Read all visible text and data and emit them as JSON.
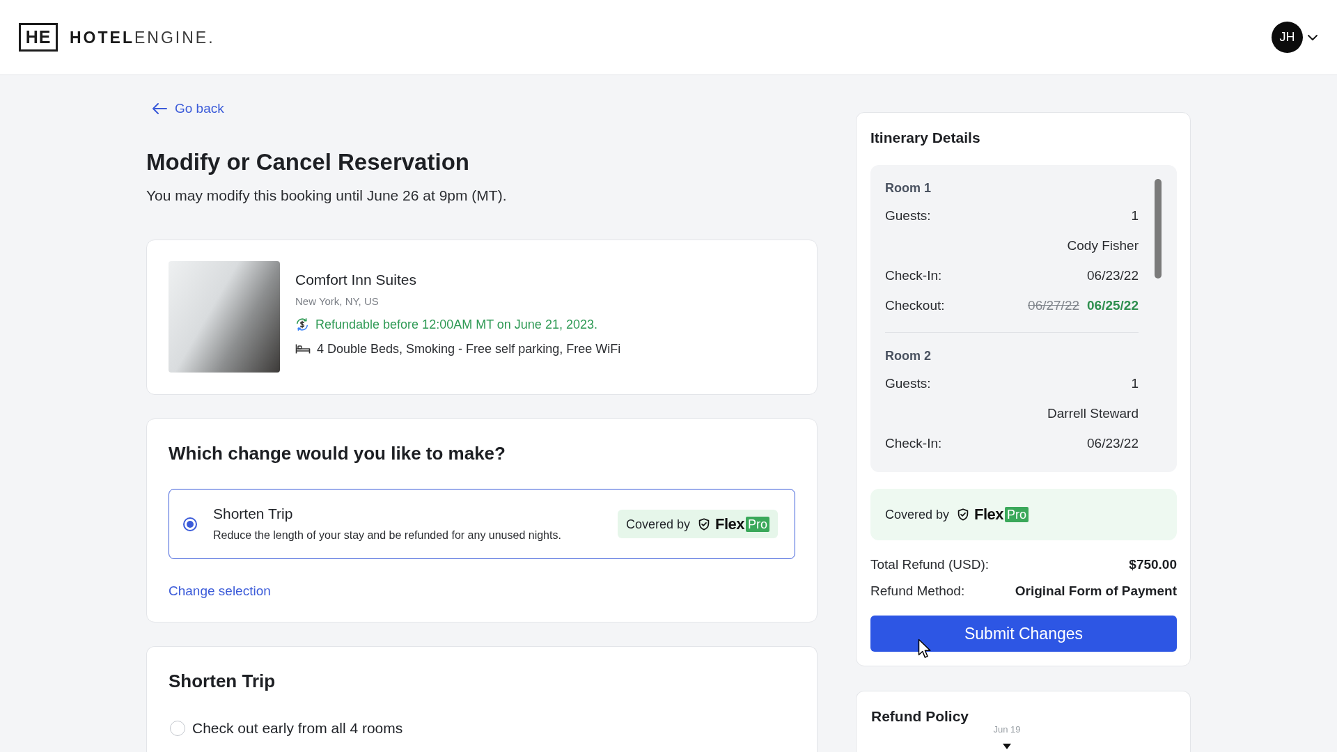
{
  "header": {
    "logo": {
      "mark": "HE",
      "wordmark": "**HOTEL**ENGINE."
    },
    "avatar": {
      "initials": "JH"
    }
  },
  "back_link": {
    "label": "Go back"
  },
  "page": {
    "title": "Modify or Cancel Reservation",
    "subtitle": "You may modify this booking until June 26 at 9pm (MT)."
  },
  "hotel": {
    "name": "Comfort Inn Suites",
    "location": "New York, NY, US",
    "details": [
      {
        "kind": "refund",
        "text": "Refundable before 12:00AM MT on June 21, 2023."
      },
      {
        "kind": "amenities",
        "text": "4 Double Beds, Smoking - Free self parking, Free WiFi"
      }
    ]
  },
  "change_section": {
    "heading": "Which change would you like to make?",
    "options": [
      {
        "title": "Shorten Trip",
        "description": "Reduce the length of your stay and be refunded for any unused nights.",
        "selected": true,
        "badge": {
          "prefix": "Covered by",
          "brand": "Flex",
          "tier": "Pro"
        }
      }
    ],
    "link": "Change selection"
  },
  "shorten_section": {
    "heading": "Shorten Trip",
    "options": [
      {
        "label": "Check out early from all 4 rooms",
        "selected": false
      }
    ]
  },
  "itinerary": {
    "title": "Itinerary Details",
    "rooms": [
      {
        "name": "Room 1",
        "rows": [
          {
            "kind": "field",
            "label": "Guests:",
            "value": "1"
          },
          {
            "kind": "guest",
            "value": "Cody Fisher"
          },
          {
            "kind": "field",
            "label": "Check-In:",
            "value": "06/23/22"
          },
          {
            "kind": "changed",
            "label": "Checkout:",
            "old_value": "06/27/22",
            "value": "06/25/22"
          }
        ]
      },
      {
        "name": "Room 2",
        "rows": [
          {
            "kind": "field",
            "label": "Guests:",
            "value": "1"
          },
          {
            "kind": "guest",
            "value": "Darrell Steward"
          },
          {
            "kind": "field",
            "label": "Check-In:",
            "value": "06/23/22"
          }
        ]
      }
    ],
    "coverage": {
      "prefix": "Covered by",
      "brand": "Flex",
      "tier": "Pro"
    },
    "summary": [
      {
        "label": "Total Refund (USD):",
        "value": "$750.00"
      },
      {
        "label": "Refund Method:",
        "value": "Original Form of Payment"
      }
    ],
    "submit_button": "Submit Changes"
  },
  "refund_policy": {
    "title": "Refund Policy",
    "timeline_label": "Jun 19"
  }
}
